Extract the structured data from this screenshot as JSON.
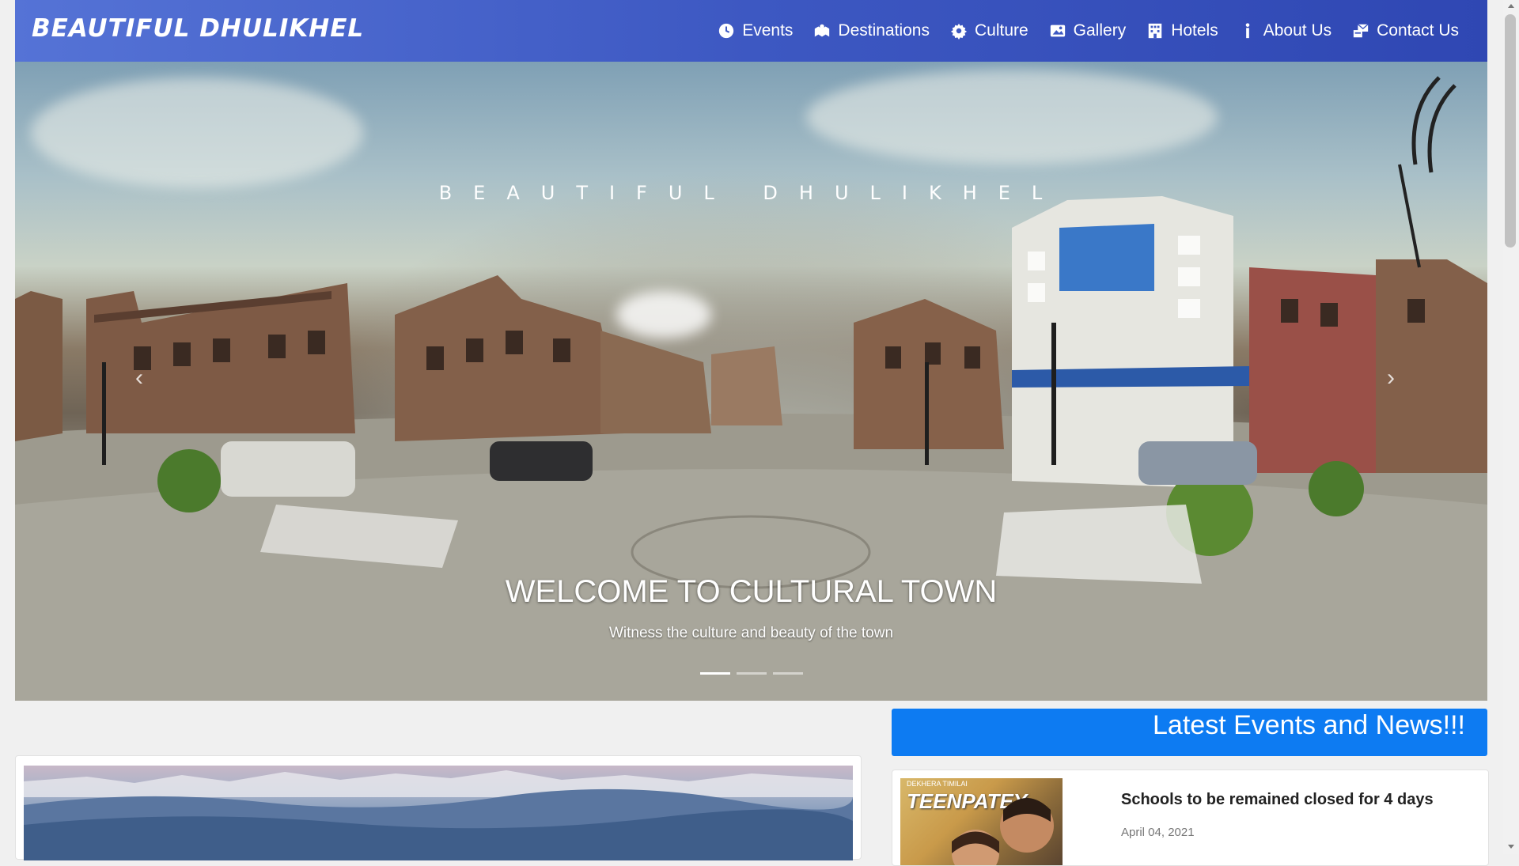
{
  "brand": "BEAUTIFUL DHULIKHEL",
  "nav": [
    {
      "label": "Events",
      "icon": "clock-icon"
    },
    {
      "label": "Destinations",
      "icon": "map-icon"
    },
    {
      "label": "Culture",
      "icon": "gear-icon"
    },
    {
      "label": "Gallery",
      "icon": "image-icon"
    },
    {
      "label": "Hotels",
      "icon": "building-icon"
    },
    {
      "label": "About Us",
      "icon": "info-icon"
    },
    {
      "label": "Contact Us",
      "icon": "contact-icon"
    }
  ],
  "hero": {
    "tagline": "BEAUTIFUL DHULIKHEL",
    "title": "WELCOME TO CULTURAL TOWN",
    "subtitle": "Witness the culture and beauty of the town",
    "prev_label": "‹",
    "next_label": "›"
  },
  "news": {
    "header": "Latest Events and News!!!",
    "items": [
      {
        "title": "Schools to be remained closed for 4 days",
        "date": "April 04, 2021",
        "thumb_title": "TEENPATEY",
        "thumb_small": "DEKHERA TIMILAI"
      }
    ]
  },
  "colors": {
    "navbar": "#3d58c2",
    "news_header": "#0d7bf2"
  }
}
